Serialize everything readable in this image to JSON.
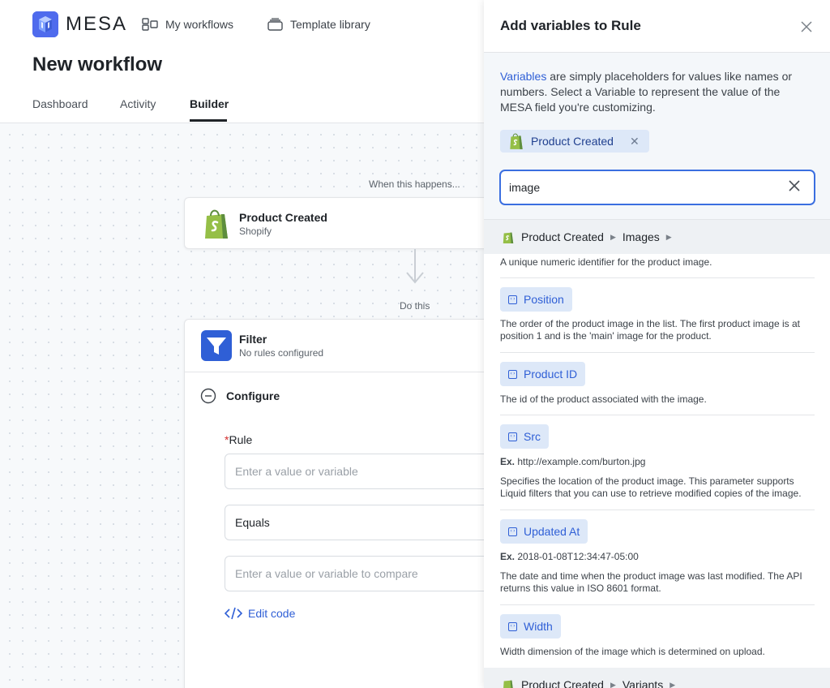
{
  "app": {
    "brand": "MESA",
    "colors": {
      "accent": "#2f5fd6",
      "brand": "#4f6bed",
      "shopify": "#95bf47"
    }
  },
  "topnav": [
    {
      "label": "My workflows",
      "icon": "workflows-icon"
    },
    {
      "label": "Template library",
      "icon": "template-library-icon"
    }
  ],
  "page": {
    "title": "New workflow"
  },
  "tabs": [
    {
      "label": "Dashboard",
      "active": false
    },
    {
      "label": "Activity",
      "active": false
    },
    {
      "label": "Builder",
      "active": true
    }
  ],
  "canvas": {
    "trigger_hint": "When this happens...",
    "trigger": {
      "title": "Product Created",
      "subtitle": "Shopify",
      "icon": "shopify-icon"
    },
    "action_hint": "Do this",
    "action": {
      "title": "Filter",
      "subtitle": "No rules configured",
      "icon": "filter-icon",
      "configure_label": "Configure",
      "rule_label": "Rule",
      "rule_required_mark": "*",
      "value_placeholder": "Enter a value or variable",
      "operator_value": "Equals",
      "compare_placeholder": "Enter a value or variable to compare",
      "edit_code_label": "Edit code"
    }
  },
  "panel": {
    "title": "Add variables to Rule",
    "intro_link": "Variables",
    "intro_text": " are simply placeholders for values like names or numbers. Select a Variable to represent the value of the MESA field you're customizing.",
    "selected_step": "Product Created",
    "search_value": "image",
    "section": {
      "step": "Product Created",
      "group": "Images"
    },
    "partial_description": "A unique numeric identifier for the product image.",
    "variables": [
      {
        "label": "Position",
        "example": "",
        "description": "The order of the product image in the list. The first product image is at position 1 and is the 'main' image for the product."
      },
      {
        "label": "Product ID",
        "example": "",
        "description": "The id of the product associated with the image."
      },
      {
        "label": "Src",
        "example_prefix": "Ex.",
        "example": "http://example.com/burton.jpg",
        "description": "Specifies the location of the product image. This parameter supports Liquid filters that you can use to retrieve modified copies of the image."
      },
      {
        "label": "Updated At",
        "example_prefix": "Ex.",
        "example": "2018-01-08T12:34:47-05:00",
        "description": "The date and time when the product image was last modified. The API returns this value in ISO 8601 format."
      },
      {
        "label": "Width",
        "example": "",
        "description": "Width dimension of the image which is determined on upload."
      }
    ],
    "next_section": {
      "step": "Product Created",
      "group": "Variants"
    }
  }
}
